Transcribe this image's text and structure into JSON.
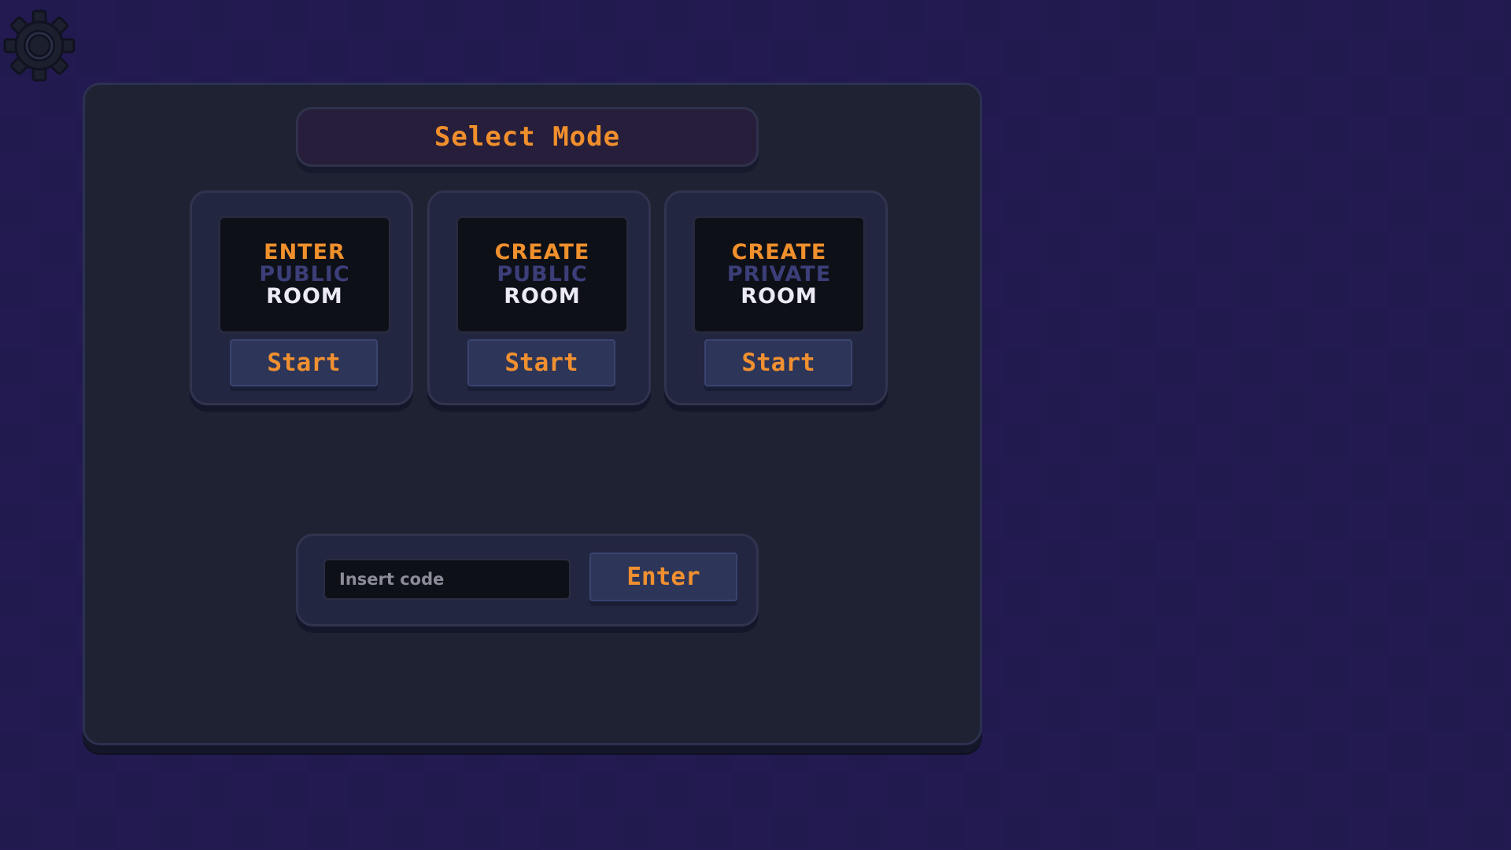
{
  "settings": {
    "icon": "gear-icon"
  },
  "title": "Select Mode",
  "modes": [
    {
      "top": "ENTER",
      "mid": "PUBLIC",
      "bot": "ROOM",
      "button": "Start"
    },
    {
      "top": "CREATE",
      "mid": "PUBLIC",
      "bot": "ROOM",
      "button": "Start"
    },
    {
      "top": "CREATE",
      "mid": "PRIVATE",
      "bot": "ROOM",
      "button": "Start"
    }
  ],
  "code_entry": {
    "placeholder": "Insert code",
    "value": "",
    "button": "Enter"
  },
  "colors": {
    "accent": "#f0902c",
    "muted_word": "#3b3e77",
    "light_word": "#eceaf2",
    "panel": "#1f2233",
    "background": "#241a52"
  }
}
